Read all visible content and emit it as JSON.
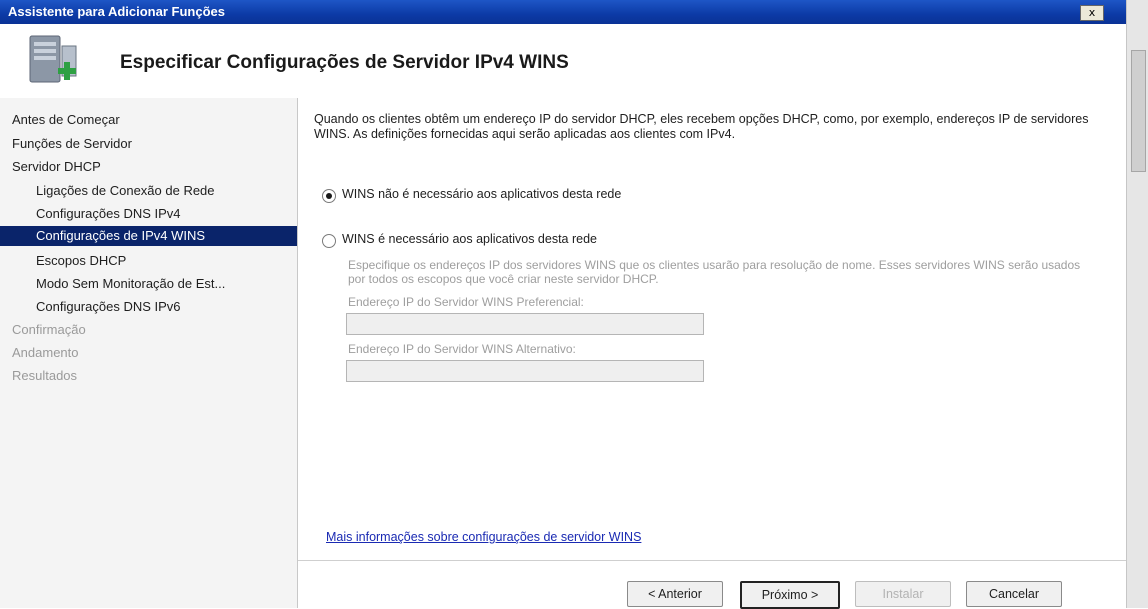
{
  "window": {
    "title": "Assistente para Adicionar Funções",
    "close_label": "x"
  },
  "header": {
    "title": "Especificar Configurações de Servidor IPv4 WINS",
    "icon": "server-add-icon"
  },
  "sidebar": {
    "items": [
      {
        "label": "Antes de Começar",
        "state": "normal",
        "level": 0
      },
      {
        "label": "Funções de Servidor",
        "state": "normal",
        "level": 0
      },
      {
        "label": "Servidor DHCP",
        "state": "normal",
        "level": 0
      },
      {
        "label": "Ligações de Conexão de Rede",
        "state": "normal",
        "level": 1
      },
      {
        "label": "Configurações DNS IPv4",
        "state": "normal",
        "level": 1
      },
      {
        "label": "Configurações de IPv4 WINS",
        "state": "selected",
        "level": 1
      },
      {
        "label": "Escopos DHCP",
        "state": "normal",
        "level": 1
      },
      {
        "label": "Modo Sem Monitoração de Est...",
        "state": "normal",
        "level": 1
      },
      {
        "label": "Configurações DNS IPv6",
        "state": "normal",
        "level": 1
      },
      {
        "label": "Confirmação",
        "state": "disabled",
        "level": 0
      },
      {
        "label": "Andamento",
        "state": "disabled",
        "level": 0
      },
      {
        "label": "Resultados",
        "state": "disabled",
        "level": 0
      }
    ]
  },
  "main": {
    "description": "Quando os clientes obtêm um endereço IP do servidor DHCP, eles recebem opções DHCP, como, por exemplo, endereços IP de servidores WINS. As definições fornecidas aqui serão aplicadas aos clientes com IPv4.",
    "option_not_required": {
      "label": "WINS não é necessário aos aplicativos desta rede",
      "checked": true
    },
    "option_required": {
      "label": "WINS é necessário aos aplicativos desta rede",
      "checked": false
    },
    "required_help": "Especifique os endereços IP dos servidores WINS que os clientes usarão para resolução de nome. Esses servidores WINS serão usados por todos os escopos que você criar neste servidor DHCP.",
    "preferred_label": "Endereço IP do Servidor WINS Preferencial:",
    "preferred_value": "",
    "alternate_label": "Endereço IP do Servidor WINS Alternativo:",
    "alternate_value": "",
    "more_info_link": "Mais informações sobre configurações de servidor WINS"
  },
  "footer": {
    "back_label": "< Anterior",
    "next_label": "Próximo >",
    "install_label": "Instalar",
    "cancel_label": "Cancelar"
  },
  "colors": {
    "titlebar": "#0c3aa6",
    "selection": "#0a246a",
    "link": "#1a2ab3"
  }
}
